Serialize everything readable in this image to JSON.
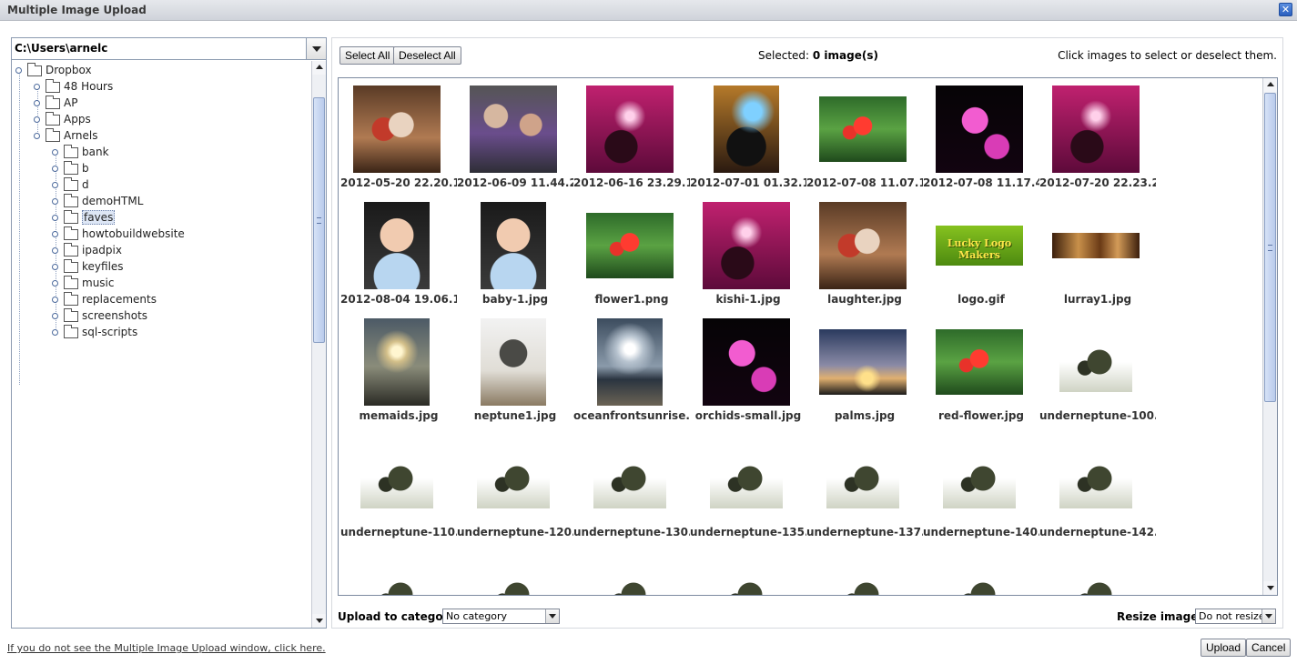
{
  "window": {
    "title": "Multiple Image Upload",
    "close_glyph": "✕"
  },
  "folder_panel": {
    "path": "C:\\Users\\arnelc",
    "tree": [
      {
        "label": "Dropbox",
        "depth": 0
      },
      {
        "label": "48 Hours",
        "depth": 1
      },
      {
        "label": "AP",
        "depth": 1
      },
      {
        "label": "Apps",
        "depth": 1
      },
      {
        "label": "Arnels",
        "depth": 1
      },
      {
        "label": "bank",
        "depth": 2
      },
      {
        "label": "b",
        "depth": 2
      },
      {
        "label": "d",
        "depth": 2
      },
      {
        "label": "demoHTML",
        "depth": 2
      },
      {
        "label": "faves",
        "depth": 2,
        "selected": true
      },
      {
        "label": "howtobuildwebsite",
        "depth": 2
      },
      {
        "label": "ipadpix",
        "depth": 2
      },
      {
        "label": "keyfiles",
        "depth": 2
      },
      {
        "label": "music",
        "depth": 2
      },
      {
        "label": "replacements",
        "depth": 2
      },
      {
        "label": "screenshots",
        "depth": 2
      },
      {
        "label": "sql-scripts",
        "depth": 2
      }
    ]
  },
  "toolbar": {
    "select_all": "Select All",
    "deselect_all": "Deselect All",
    "selected_label": "Selected:",
    "selected_count": "0 image(s)",
    "hint": "Click images to select or deselect them."
  },
  "images": [
    {
      "name": "2012-05-20 22.20.1...",
      "kind": "people-warm"
    },
    {
      "name": "2012-06-09 11.44.2...",
      "kind": "people-purple"
    },
    {
      "name": "2012-06-16 23.29.1...",
      "kind": "stage-magenta"
    },
    {
      "name": "2012-07-01 01.32.1...",
      "kind": "stage-blue",
      "portrait": true
    },
    {
      "name": "2012-07-08 11.07.1...",
      "kind": "flower-red",
      "landscape": true
    },
    {
      "name": "2012-07-08 11.17.4...",
      "kind": "orchid"
    },
    {
      "name": "2012-07-20 22.23.2...",
      "kind": "stage-magenta"
    },
    {
      "name": "2012-08-04 19.06.1...",
      "kind": "baby",
      "portrait": true
    },
    {
      "name": "baby-1.jpg",
      "kind": "baby",
      "portrait": true
    },
    {
      "name": "flower1.png",
      "kind": "flower-red",
      "landscape": true
    },
    {
      "name": "kishi-1.jpg",
      "kind": "stage-magenta"
    },
    {
      "name": "laughter.jpg",
      "kind": "people-warm"
    },
    {
      "name": "logo.gif",
      "kind": "logo",
      "logo_text": "Lucky Logo Makers"
    },
    {
      "name": "lurray1.jpg",
      "kind": "cave"
    },
    {
      "name": "memaids.jpg",
      "kind": "sunset-people",
      "portrait": true
    },
    {
      "name": "neptune1.jpg",
      "kind": "statue",
      "portrait": true
    },
    {
      "name": "oceanfrontsunrise....",
      "kind": "ocean",
      "portrait": true
    },
    {
      "name": "orchids-small.jpg",
      "kind": "orchid"
    },
    {
      "name": "palms.jpg",
      "kind": "palms",
      "landscape": true
    },
    {
      "name": "red-flower.jpg",
      "kind": "flower-red",
      "landscape": true
    },
    {
      "name": "underneptune-100...",
      "kind": "statue-cut",
      "landscape": true
    },
    {
      "name": "underneptune-110...",
      "kind": "statue-cut",
      "landscape": true
    },
    {
      "name": "underneptune-120...",
      "kind": "statue-cut",
      "landscape": true
    },
    {
      "name": "underneptune-130...",
      "kind": "statue-cut",
      "landscape": true
    },
    {
      "name": "underneptune-135...",
      "kind": "statue-cut",
      "landscape": true
    },
    {
      "name": "underneptune-137...",
      "kind": "statue-cut",
      "landscape": true
    },
    {
      "name": "underneptune-140...",
      "kind": "statue-cut",
      "landscape": true
    },
    {
      "name": "underneptune-142...",
      "kind": "statue-cut",
      "landscape": true
    },
    {
      "name": "",
      "kind": "statue-cut",
      "landscape": true
    },
    {
      "name": "",
      "kind": "statue-cut",
      "landscape": true
    },
    {
      "name": "",
      "kind": "statue-cut",
      "landscape": true
    },
    {
      "name": "",
      "kind": "statue-cut",
      "landscape": true
    },
    {
      "name": "",
      "kind": "statue-cut",
      "landscape": true
    },
    {
      "name": "",
      "kind": "statue-cut",
      "landscape": true
    },
    {
      "name": "",
      "kind": "statue-cut",
      "landscape": true
    }
  ],
  "bottom": {
    "category_label": "Upload to category:",
    "category_value": "No category",
    "resize_label": "Resize images",
    "resize_value": "Do not resize"
  },
  "footer": {
    "help_link": "If you do not see the Multiple Image Upload window, click here.",
    "upload": "Upload",
    "cancel": "Cancel"
  }
}
